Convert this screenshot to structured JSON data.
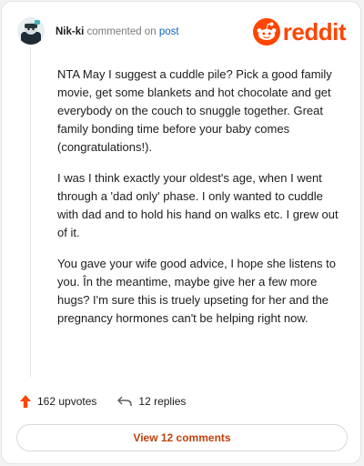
{
  "header": {
    "username": "Nik-ki",
    "commented_on": "commented on",
    "post_link": "post",
    "brand": "reddit"
  },
  "comment": {
    "paragraphs": [
      "NTA May I suggest a cuddle pile? Pick a good family movie, get some blankets and hot chocolate and get everybody on the couch to snuggle together. Great family bonding time before your baby comes (congratulations!).",
      "I was I think exactly your oldest's age, when I went through a 'dad only' phase. I only wanted to cuddle with dad and to hold his hand on walks etc. I grew out of it.",
      "You gave your wife good advice, I hope she listens to you. În the meantime, maybe give her a few more hugs? I'm sure this is truely upseting for her and the pregnancy hormones can't be helping right now."
    ]
  },
  "actions": {
    "upvotes": "162 upvotes",
    "replies": "12 replies"
  },
  "view_button": "View 12 comments",
  "colors": {
    "brand": "#ff4500",
    "link": "#0a66c2",
    "button_text": "#c2410c"
  },
  "icons": {
    "upvote": "arrow-up-icon",
    "reply": "reply-arrow-icon",
    "logo": "reddit-snoo-icon",
    "avatar": "user-avatar"
  }
}
